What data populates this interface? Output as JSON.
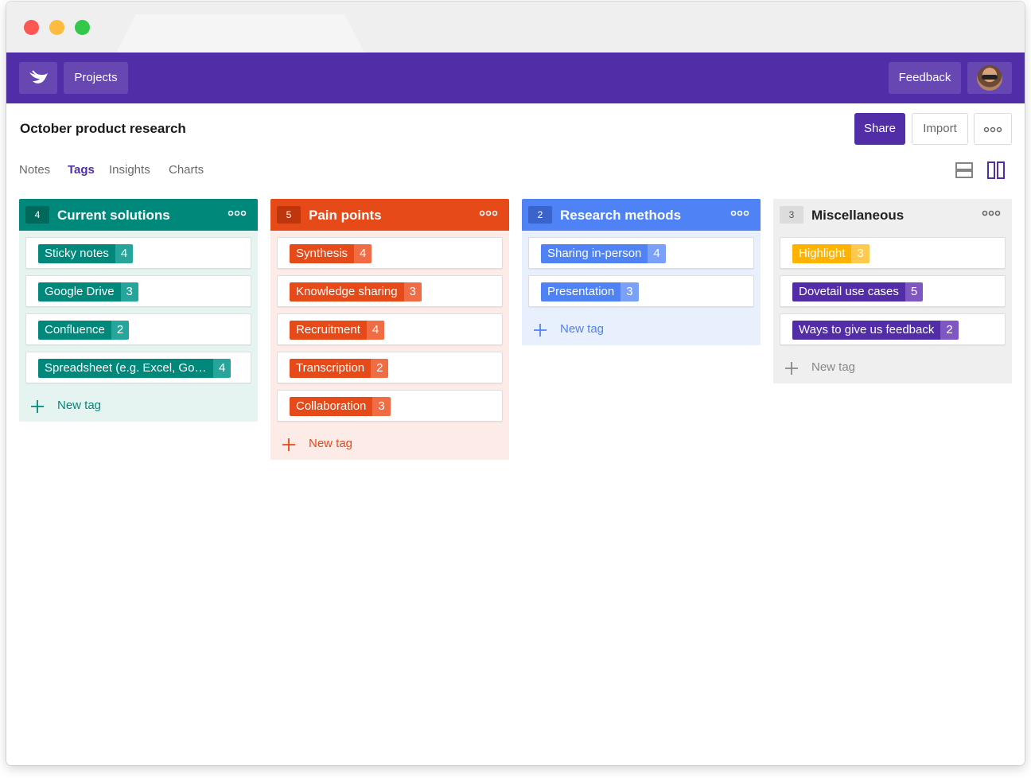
{
  "topbar": {
    "projects_label": "Projects",
    "feedback_label": "Feedback",
    "color": "#512da8"
  },
  "page": {
    "title": "October product research",
    "share_label": "Share",
    "import_label": "Import"
  },
  "subtabs": [
    "Notes",
    "Tags",
    "Insights",
    "Charts"
  ],
  "active_subtab": "Tags",
  "new_tag_label": "New tag",
  "columns": [
    {
      "count": "4",
      "title": "Current solutions",
      "colors": {
        "head": "#00897b",
        "badge": "#00695c",
        "body": "#e6f4f1",
        "tag": "#00897b",
        "tagcount": "#26a69a",
        "newtag": "#00897b"
      },
      "tags": [
        {
          "label": "Sticky notes",
          "count": "4"
        },
        {
          "label": "Google Drive",
          "count": "3"
        },
        {
          "label": "Confluence",
          "count": "2"
        },
        {
          "label": "Spreadsheet (e.g. Excel, Goo...",
          "count": "4"
        }
      ]
    },
    {
      "count": "5",
      "title": "Pain points",
      "colors": {
        "head": "#e64a19",
        "badge": "#bf360c",
        "body": "#fcebe6",
        "tag": "#e64a19",
        "tagcount": "#ef6c45",
        "newtag": "#e64a19"
      },
      "tags": [
        {
          "label": "Synthesis",
          "count": "4"
        },
        {
          "label": "Knowledge sharing",
          "count": "3"
        },
        {
          "label": "Recruitment",
          "count": "4"
        },
        {
          "label": "Transcription",
          "count": "2"
        },
        {
          "label": "Collaboration",
          "count": "3"
        }
      ]
    },
    {
      "count": "2",
      "title": "Research methods",
      "colors": {
        "head": "#4f83f5",
        "badge": "#3a63cc",
        "body": "#e8effd",
        "tag": "#4f83f5",
        "tagcount": "#7aa1f7",
        "newtag": "#4f83f5"
      },
      "tags": [
        {
          "label": "Sharing in-person",
          "count": "4"
        },
        {
          "label": "Presentation",
          "count": "3"
        }
      ]
    },
    {
      "count": "3",
      "title": "Miscellaneous",
      "colors": {
        "head": "#efefef",
        "badge": "#dcdcdc",
        "body": "#efefef",
        "tag": "#512da8",
        "tagcount": "#7e57c2",
        "newtag": "#888888"
      },
      "tags": [
        {
          "label": "Highlight",
          "count": "3",
          "color": "#ffb300",
          "countcolor": "#ffc94d"
        },
        {
          "label": "Dovetail use cases",
          "count": "5",
          "color": "#512da8",
          "countcolor": "#7e57c2"
        },
        {
          "label": "Ways to give us feedback",
          "count": "2",
          "color": "#512da8",
          "countcolor": "#7e57c2"
        }
      ]
    }
  ]
}
